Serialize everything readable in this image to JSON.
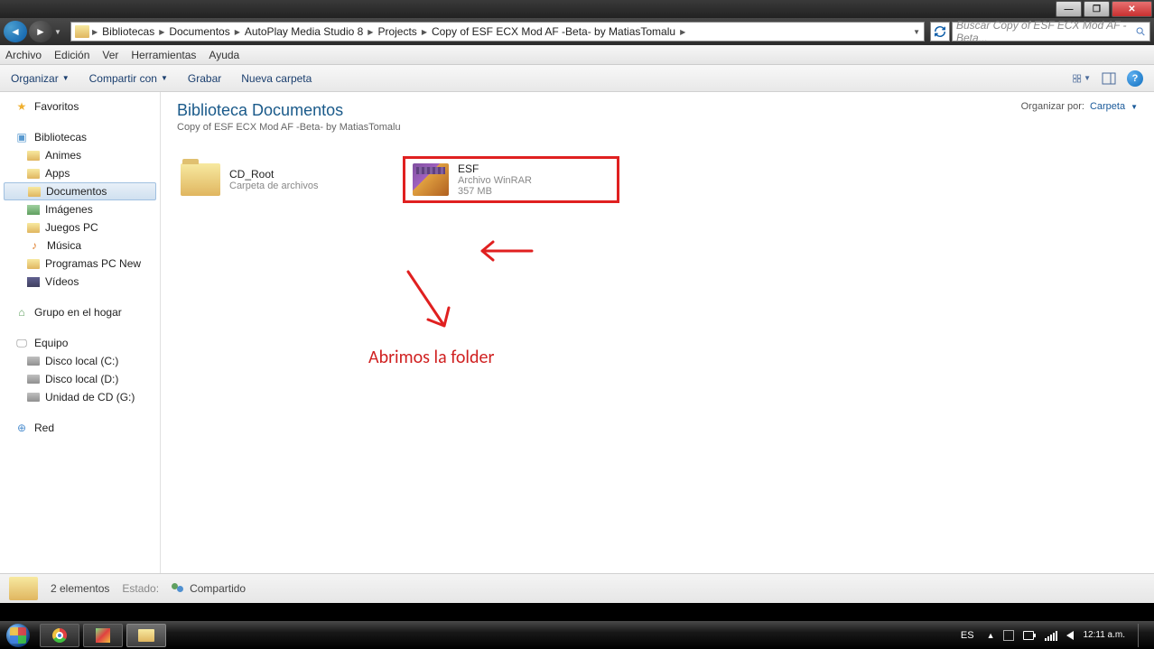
{
  "titlebar": {
    "min": "—",
    "max": "❐",
    "close": "✕"
  },
  "nav": {
    "crumbs": [
      "Bibliotecas",
      "Documentos",
      "AutoPlay Media Studio 8",
      "Projects",
      "Copy of ESF ECX Mod AF -Beta- by MatiasTomalu"
    ],
    "search_placeholder": "Buscar Copy of ESF ECX Mod AF -Beta..."
  },
  "menu": {
    "items": [
      "Archivo",
      "Edición",
      "Ver",
      "Herramientas",
      "Ayuda"
    ]
  },
  "toolbar": {
    "organize": "Organizar",
    "share": "Compartir con",
    "burn": "Grabar",
    "newfolder": "Nueva carpeta"
  },
  "sidebar": {
    "favorites": "Favoritos",
    "libraries": "Bibliotecas",
    "lib_items": [
      "Animes",
      "Apps",
      "Documentos",
      "Imágenes",
      "Juegos PC",
      "Música",
      "Programas PC New",
      "Vídeos"
    ],
    "homegroup": "Grupo en el hogar",
    "computer": "Equipo",
    "drives": [
      "Disco local (C:)",
      "Disco local (D:)",
      "Unidad de CD (G:)"
    ],
    "network": "Red"
  },
  "content": {
    "lib_title": "Biblioteca Documentos",
    "lib_sub": "Copy of ESF ECX Mod AF -Beta- by MatiasTomalu",
    "org_label": "Organizar por:",
    "org_value": "Carpeta",
    "files": {
      "cdroot": {
        "name": "CD_Root",
        "sub": "Carpeta de archivos"
      },
      "esf": {
        "name": "ESF",
        "sub": "Archivo WinRAR",
        "size": "357 MB"
      }
    },
    "annotation": "Abrimos la folder"
  },
  "status": {
    "count": "2 elementos",
    "state_label": "Estado:",
    "state_value": "Compartido"
  },
  "taskbar": {
    "lang": "ES",
    "time": "12:11 a.m."
  }
}
